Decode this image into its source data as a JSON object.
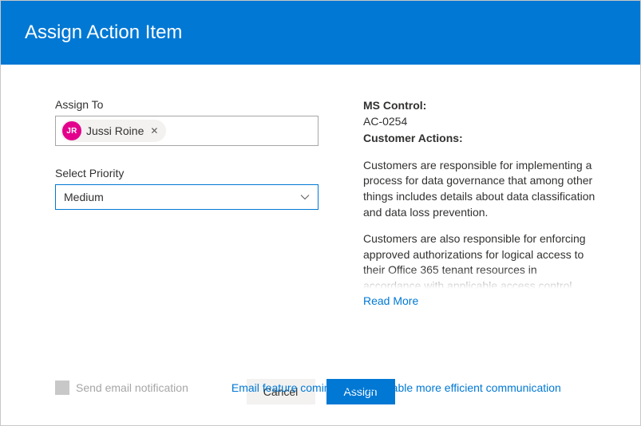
{
  "header": {
    "title": "Assign Action Item"
  },
  "assign_to": {
    "label": "Assign To",
    "person": {
      "initials": "JR",
      "name": "Jussi Roine",
      "remove_glyph": "✕"
    }
  },
  "priority": {
    "label": "Select Priority",
    "value": "Medium"
  },
  "details": {
    "ms_control_label": "MS Control:",
    "ms_control_value": "AC-0254",
    "customer_actions_label": "Customer Actions:",
    "paragraph1": "Customers are responsible for implementing a process for data governance that among other things includes details about data classification and data loss prevention.",
    "paragraph2": "Customers are also responsible for enforcing approved authorizations for logical access to their Office 365 tenant resources in accordance with applicable access control",
    "read_more": "Read More"
  },
  "email": {
    "label": "Send email notification",
    "note": "Email feature coming soon to enable more efficient communication"
  },
  "footer": {
    "cancel": "Cancel",
    "assign": "Assign"
  }
}
